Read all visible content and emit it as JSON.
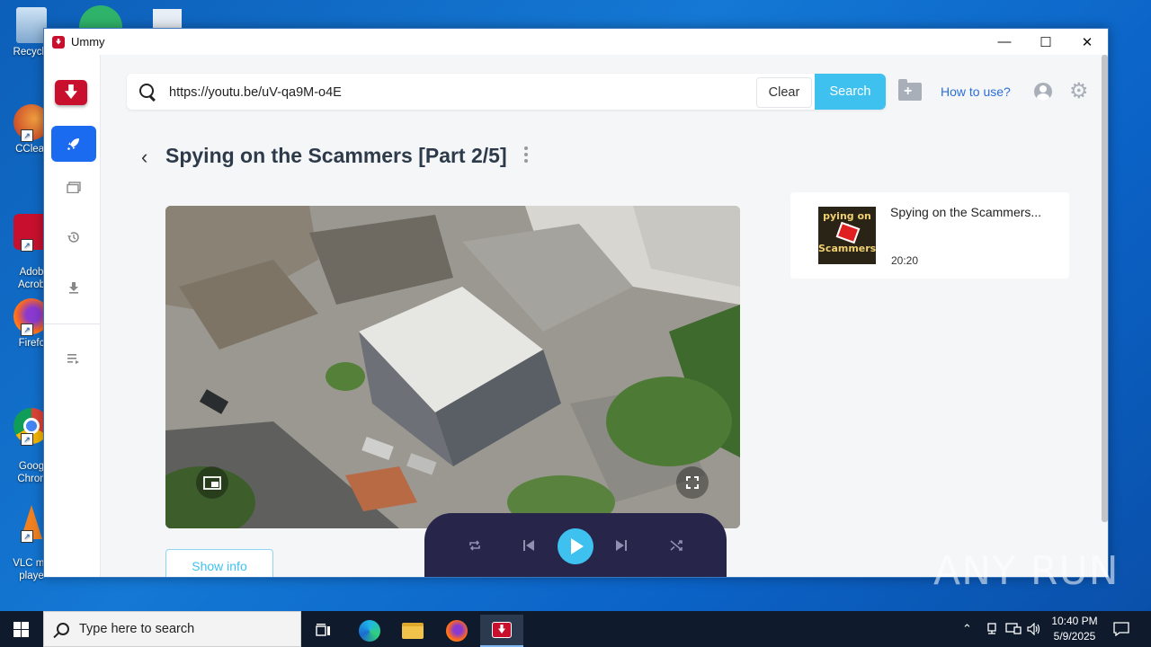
{
  "desktop": {
    "icons": [
      {
        "label": "Recycle",
        "name": "recycle-bin-icon"
      },
      {
        "label": "CClear",
        "name": "ccleaner-icon"
      },
      {
        "label": "Adob\nAcrob",
        "name": "adobe-acrobat-icon"
      },
      {
        "label": "Firefc",
        "name": "firefox-icon"
      },
      {
        "label": "Goog\nChron",
        "name": "chrome-icon"
      },
      {
        "label": "VLC me\nplaye",
        "name": "vlc-icon"
      }
    ]
  },
  "window": {
    "title": "Ummy",
    "controls": {
      "minimize": "—",
      "maximize": "☐",
      "close": "✕"
    }
  },
  "search": {
    "url": "https://youtu.be/uV-qa9M-o4E",
    "clear_label": "Clear",
    "search_label": "Search"
  },
  "header": {
    "howto_label": "How to use?"
  },
  "video": {
    "title": "Spying on the Scammers [Part 2/5]",
    "show_info_label": "Show info"
  },
  "playlist": [
    {
      "title": "Spying on the Scammers...",
      "duration": "20:20",
      "thumb_top": "pying on th",
      "thumb_bottom": "Scammers"
    }
  ],
  "taskbar": {
    "search_placeholder": "Type here to search",
    "time": "10:40 PM",
    "date": "5/9/2025"
  },
  "watermark": "ANY RUN",
  "colors": {
    "accent": "#3fc1f0",
    "brand_red": "#c8102e",
    "active_rail": "#1a6bf0",
    "control_bar": "#27264a"
  }
}
